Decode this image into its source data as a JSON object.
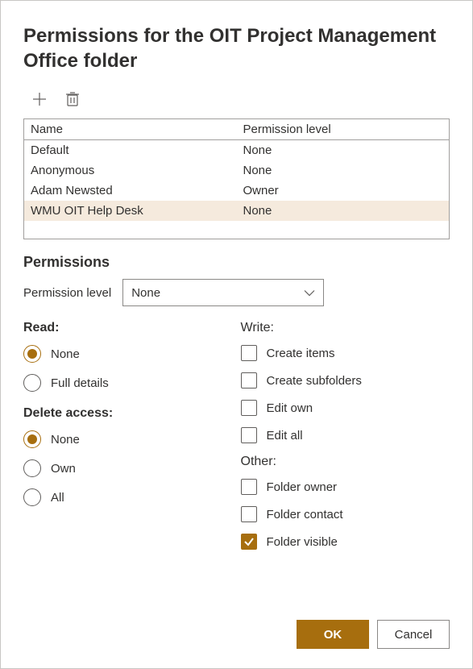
{
  "dialog": {
    "title": "Permissions for the OIT Project Management Office folder"
  },
  "table": {
    "headers": {
      "name": "Name",
      "level": "Permission level"
    },
    "rows": [
      {
        "name": "Default",
        "level": "None",
        "selected": false
      },
      {
        "name": "Anonymous",
        "level": "None",
        "selected": false
      },
      {
        "name": "Adam Newsted",
        "level": "Owner",
        "selected": false
      },
      {
        "name": "WMU OIT Help Desk",
        "level": "None",
        "selected": true
      }
    ]
  },
  "permissions": {
    "section_title": "Permissions",
    "level_label": "Permission level",
    "level_value": "None"
  },
  "read": {
    "title": "Read:",
    "options": {
      "none": "None",
      "full": "Full details"
    },
    "selected": "none"
  },
  "delete": {
    "title": "Delete access:",
    "options": {
      "none": "None",
      "own": "Own",
      "all": "All"
    },
    "selected": "none"
  },
  "write": {
    "title": "Write:",
    "options": {
      "create_items": "Create items",
      "create_subfolders": "Create subfolders",
      "edit_own": "Edit own",
      "edit_all": "Edit all"
    },
    "checked": []
  },
  "other": {
    "title": "Other:",
    "options": {
      "folder_owner": "Folder owner",
      "folder_contact": "Folder contact",
      "folder_visible": "Folder visible"
    },
    "checked": [
      "folder_visible"
    ]
  },
  "buttons": {
    "ok": "OK",
    "cancel": "Cancel"
  },
  "colors": {
    "accent": "#a76e0e",
    "selected_row": "#f5eadd"
  }
}
